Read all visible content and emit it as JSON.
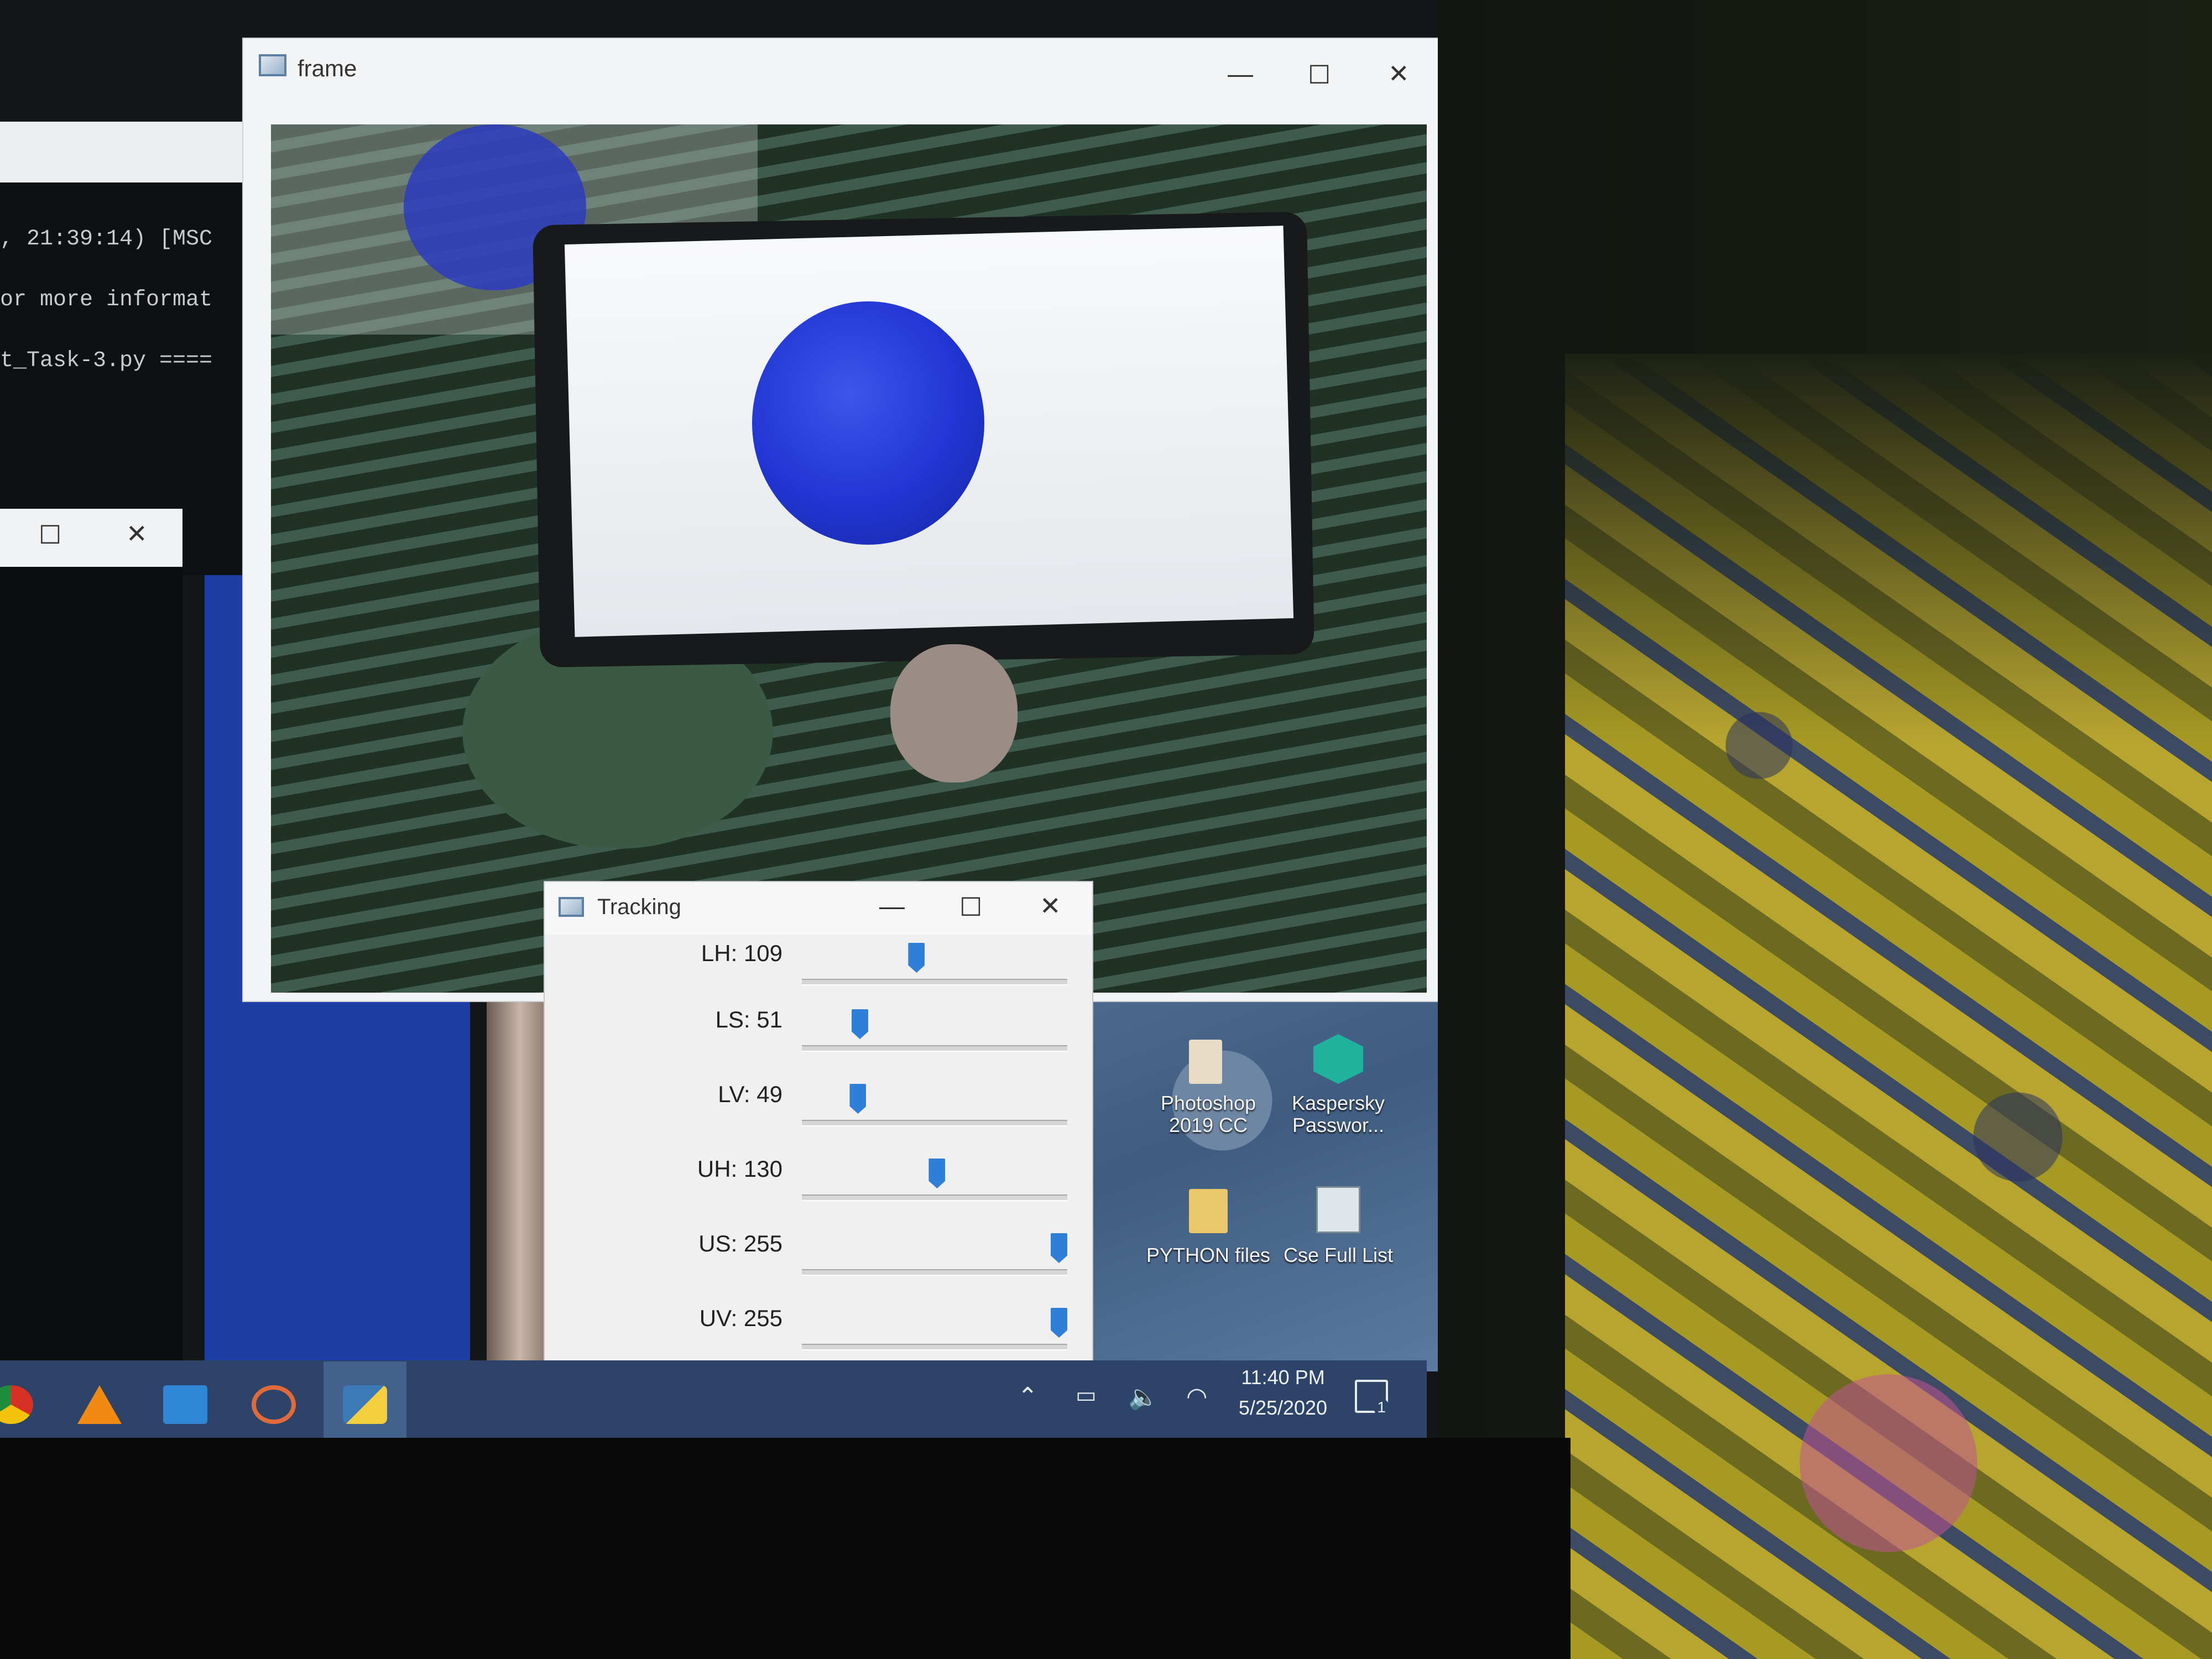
{
  "console": {
    "lines": [
      ", 21:39:14) [MSC",
      "or more informat",
      "t_Task-3.py ===="
    ]
  },
  "frame_window": {
    "title": "frame"
  },
  "tracking_window": {
    "title": "Tracking",
    "sliders": [
      {
        "label": "LH: 109",
        "value": 109,
        "max": 255
      },
      {
        "label": "LS: 51",
        "value": 51,
        "max": 255
      },
      {
        "label": "LV: 49",
        "value": 49,
        "max": 255
      },
      {
        "label": "UH: 130",
        "value": 130,
        "max": 255
      },
      {
        "label": "US: 255",
        "value": 255,
        "max": 255
      },
      {
        "label": "UV: 255",
        "value": 255,
        "max": 255
      }
    ]
  },
  "desktop_icons": [
    {
      "label_line1": "Photoshop",
      "label_line2": "2019 CC",
      "icon": "photoshop-shortcut-icon"
    },
    {
      "label_line1": "Kaspersky",
      "label_line2": "Passwor...",
      "icon": "kaspersky-password-icon"
    },
    {
      "label_line1": "PYTHON files",
      "label_line2": "",
      "icon": "folder-icon"
    },
    {
      "label_line1": "Cse Full List",
      "label_line2": "",
      "icon": "spreadsheet-icon"
    }
  ],
  "taskbar": {
    "apps": [
      "chrome-icon",
      "vlc-icon",
      "mail-icon",
      "media-player-icon",
      "python-idle-icon"
    ],
    "tray_icons": [
      "chevron-up-icon",
      "battery-icon",
      "volume-icon",
      "wifi-icon"
    ],
    "time": "11:40 PM",
    "date": "5/25/2020",
    "notification_count": "1"
  },
  "colors": {
    "taskbar": "#2d4468",
    "slider_thumb": "#2f7fd8",
    "ball": "#2135d2"
  }
}
